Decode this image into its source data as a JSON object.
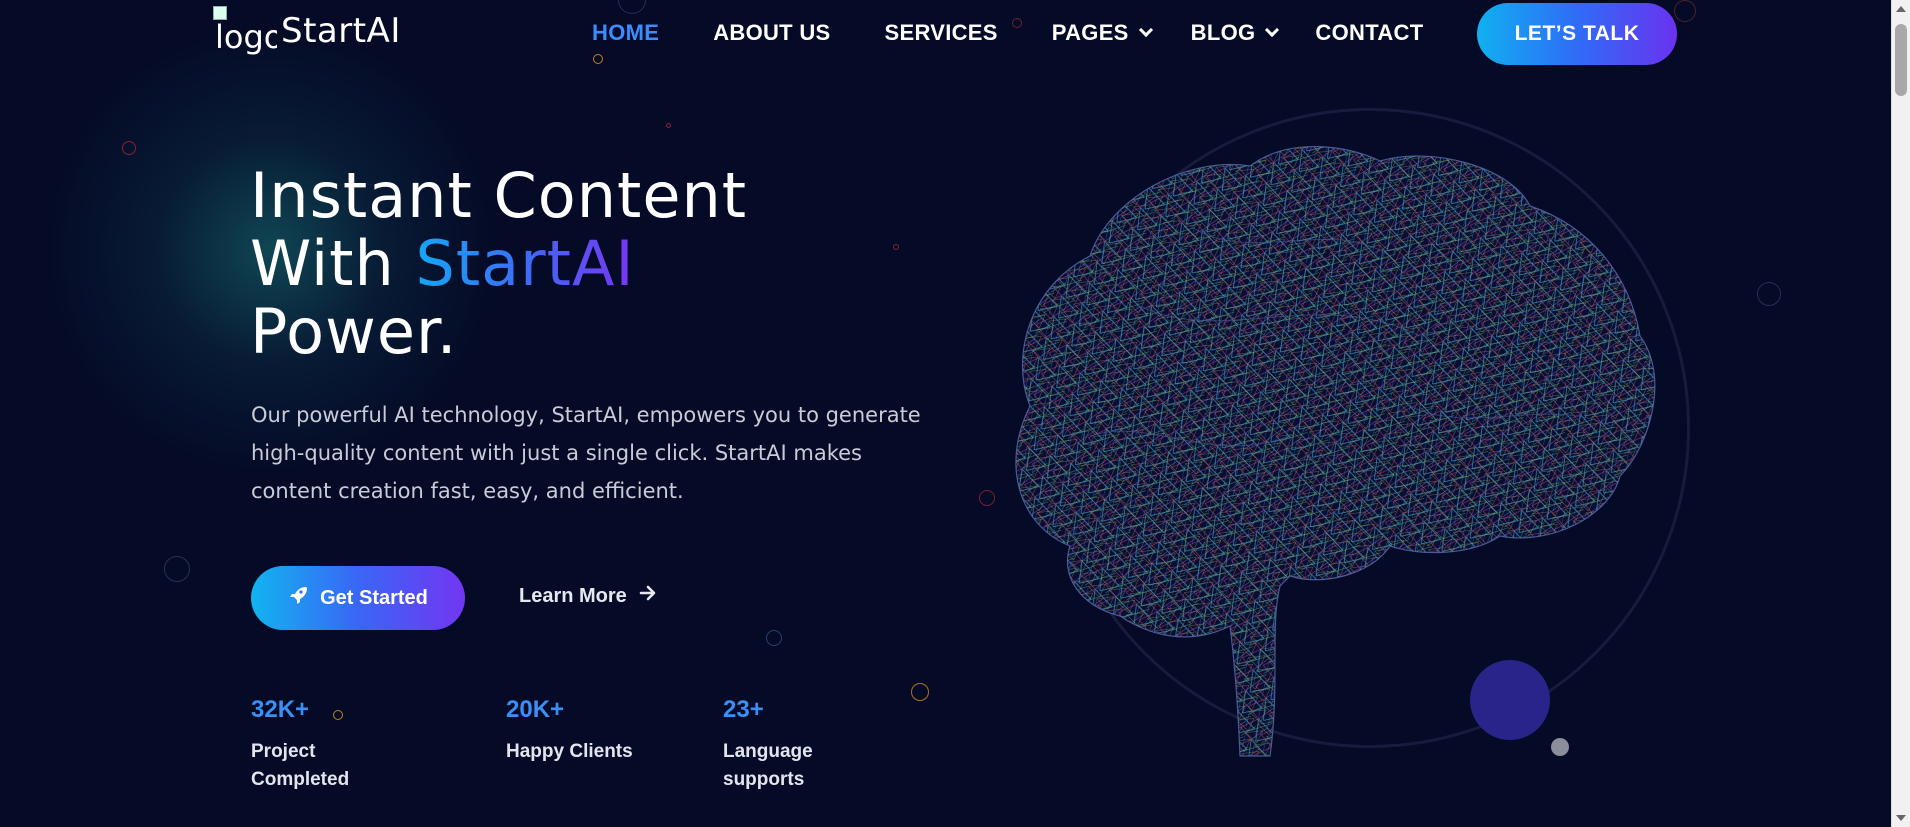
{
  "header": {
    "logo_alt": "logo",
    "logo_text": "StartAI",
    "nav": [
      {
        "label": "HOME",
        "active": true
      },
      {
        "label": "ABOUT US",
        "active": false
      },
      {
        "label": "SERVICES",
        "active": false
      },
      {
        "label": "PAGES",
        "active": false,
        "dropdown": true
      },
      {
        "label": "BLOG",
        "active": false,
        "dropdown": true
      },
      {
        "label": "CONTACT",
        "active": false
      }
    ],
    "cta_label": "LET’S TALK"
  },
  "hero": {
    "headline_line1": "Instant Content",
    "headline_line2_prefix": "With ",
    "headline_line2_accent": "StartAI",
    "headline_line3": "Power.",
    "description": "Our powerful AI technology, StartAI, empowers you to generate high-quality content with just a single click. StartAI makes content creation fast, easy, and efficient.",
    "primary_button": "Get Started",
    "secondary_button": "Learn More",
    "primary_icon": "rocket-icon",
    "secondary_icon": "arrow-right-icon"
  },
  "stats": [
    {
      "value": "32K+",
      "label": "Project Completed"
    },
    {
      "value": "20K+",
      "label": "Happy Clients"
    },
    {
      "value": "23+",
      "label": "Language supports"
    }
  ],
  "colors": {
    "background": "#050a26",
    "accent_blue": "#3b8cff",
    "gradient_start": "#10b0f0",
    "gradient_end": "#6a32f0"
  }
}
